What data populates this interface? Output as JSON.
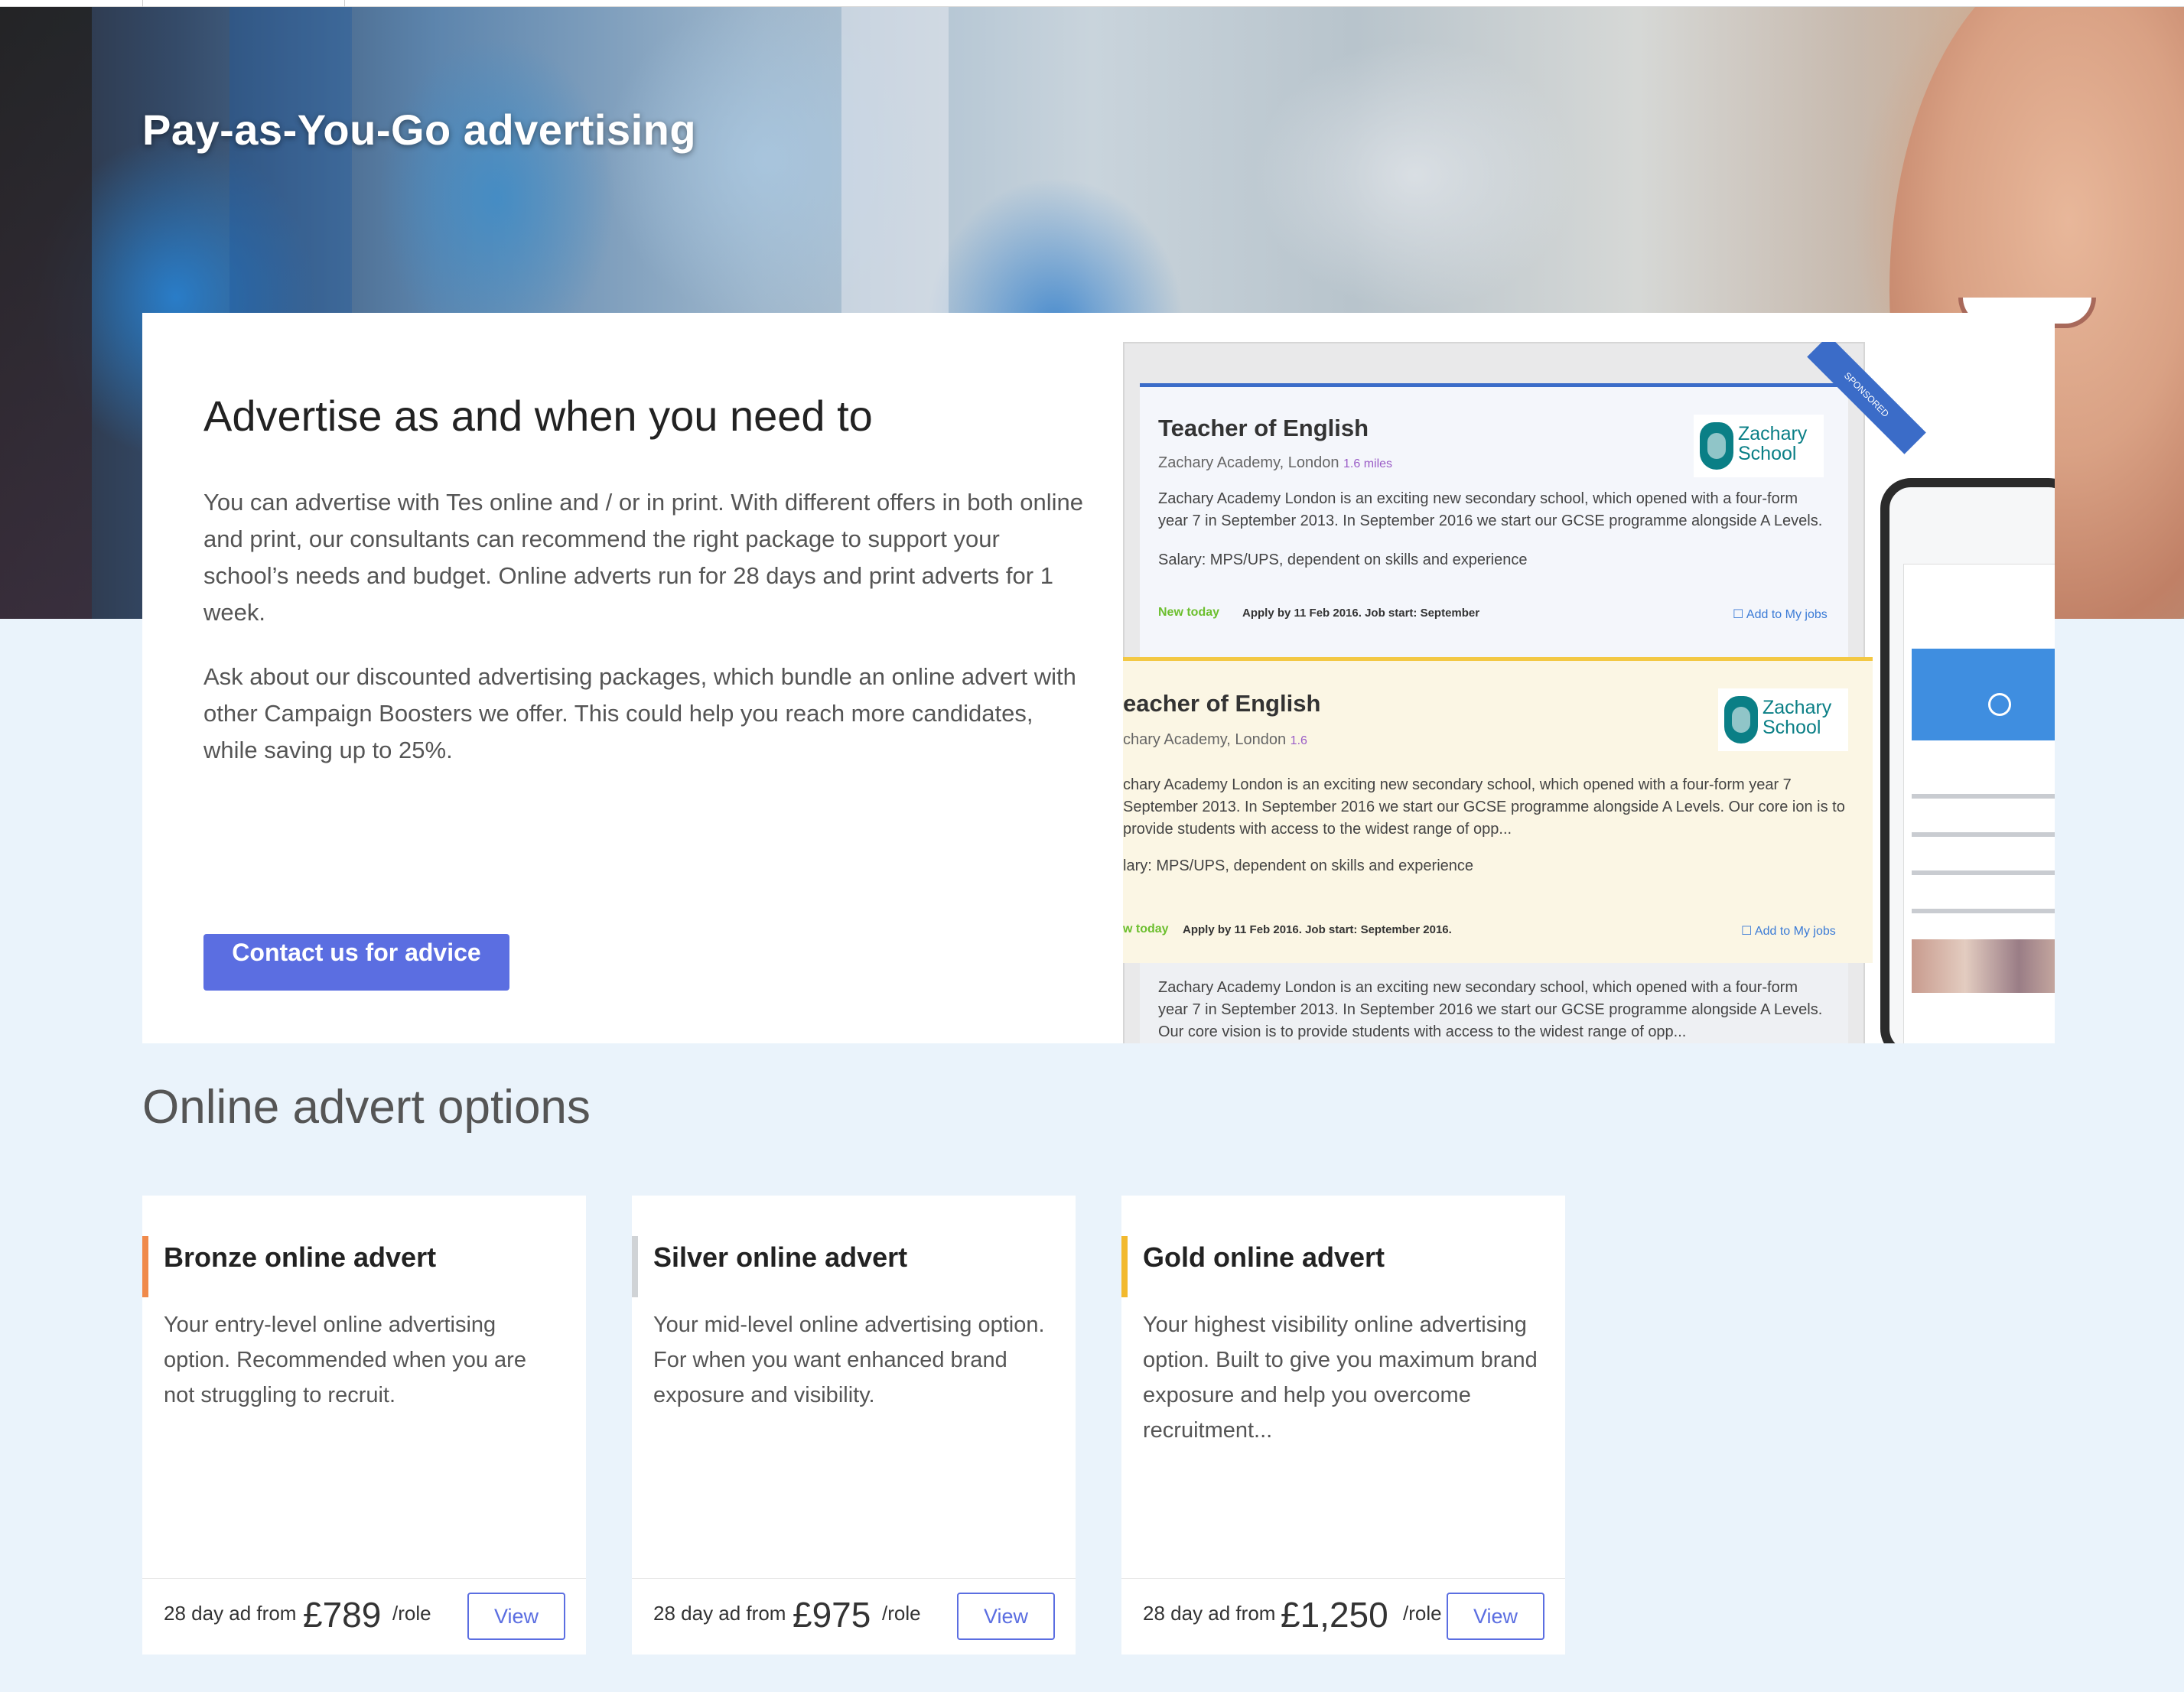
{
  "hero": {
    "title": "Pay-as-You-Go advertising"
  },
  "intro": {
    "heading": "Advertise as and when you need to",
    "paragraph1": "You can advertise with Tes online and / or in print. With different offers in both online and print, our consultants can recommend the right package to support your school’s needs and budget. Online adverts run for 28 days and print adverts for 1 week.",
    "paragraph2": "Ask about our discounted advertising packages, which bundle an online advert with other Campaign Boosters we offer. This could help you reach more candidates, while saving up to 25%.",
    "contact_button": "Contact us for advice"
  },
  "mockup": {
    "card1": {
      "title": "Teacher of English",
      "location": "Zachary Academy, London",
      "distance": "1.6 miles",
      "description": "Zachary Academy London is an exciting new secondary school, which opened with a four-form year 7 in September 2013. In September 2016 we start our GCSE programme alongside A Levels.",
      "salary": "Salary: MPS/UPS, dependent on skills and experience",
      "new_today": "New today",
      "apply": "Apply by 11 Feb 2016. Job start: September",
      "add_to_jobs": "Add to My jobs",
      "sponsored": "SPONSORED"
    },
    "card2": {
      "title": "eacher of English",
      "location": "chary Academy, London",
      "distance": "1.6",
      "description": "chary Academy London is an exciting new secondary school, which opened with a four-form year 7 September 2013. In September 2016 we start our GCSE programme alongside A Levels. Our core ion is to provide students with access to the widest range of opp...",
      "salary": "lary: MPS/UPS, dependent on skills and experience",
      "new_today": "w today",
      "apply": "Apply by 11 Feb 2016. Job start: September 2016.",
      "add_to_jobs": "Add to My jobs"
    },
    "card3": {
      "description": "Zachary Academy London is an exciting new secondary school, which opened with a four-form year 7 in September 2013. In September 2016 we start our GCSE programme alongside A Levels. Our core vision is to provide students with access to the widest range of opp..."
    },
    "logo_line1": "Zachary",
    "logo_line2": "School"
  },
  "options": {
    "title": "Online advert options",
    "items": [
      {
        "name": "Bronze online advert",
        "description": "Your entry-level online advertising option. Recommended when you are not struggling to recruit.",
        "from_label": "28 day ad from",
        "price": "£789",
        "per": "/role",
        "view_label": "View",
        "accent": "#f08a4b"
      },
      {
        "name": "Silver online advert",
        "description": "Your mid-level online advertising option. For when you want enhanced brand exposure and visibility.",
        "from_label": "28 day ad from",
        "price": "£975",
        "per": "/role",
        "view_label": "View",
        "accent": "#d0d3d6"
      },
      {
        "name": "Gold online advert",
        "description": "Your highest visibility online advertising option. Built to give you maximum brand exposure and help you overcome recruitment...",
        "from_label": "28 day ad from",
        "price": "£1,250",
        "per": "/role",
        "view_label": "View",
        "accent": "#f2b92e"
      }
    ]
  },
  "colors": {
    "primary": "#5b6ee1",
    "page_background": "#eaf3fb"
  }
}
